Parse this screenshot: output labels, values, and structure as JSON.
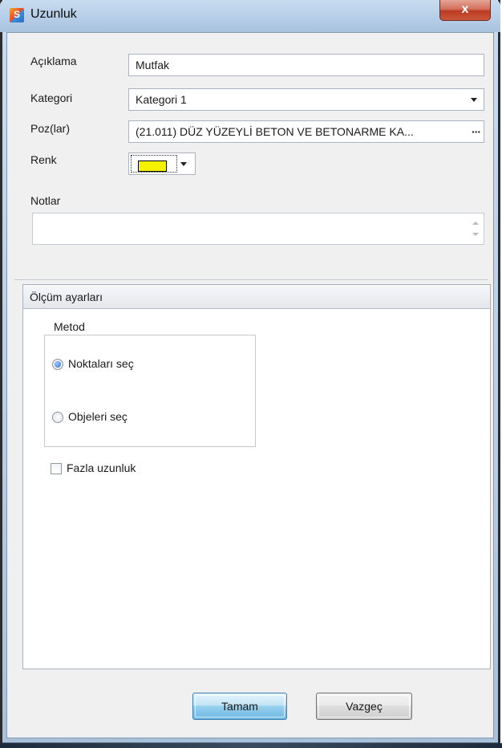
{
  "window": {
    "title": "Uzunluk",
    "close_glyph": "x"
  },
  "form": {
    "aciklama_label": "Açıklama",
    "aciklama_value": "Mutfak",
    "kategori_label": "Kategori",
    "kategori_value": "Kategori 1",
    "poz_label": "Poz(lar)",
    "poz_value": "(21.011) DÜZ YÜZEYLİ BETON VE BETONARME KA...",
    "poz_button": "···",
    "renk_label": "Renk",
    "renk_color": "#f5f200",
    "notlar_label": "Notlar",
    "notlar_value": ""
  },
  "measurement": {
    "group_title": "Ölçüm ayarları",
    "method_title": "Metod",
    "options": [
      {
        "label": "Noktaları seç",
        "selected": true
      },
      {
        "label": "Objeleri seç",
        "selected": false
      }
    ],
    "extra_length_label": "Fazla uzunluk",
    "extra_length_checked": false
  },
  "buttons": {
    "ok": "Tamam",
    "cancel": "Vazgeç"
  },
  "icons": {
    "app": "app-icon",
    "close": "close-icon",
    "dropdown": "chevron-down-icon",
    "more": "ellipsis-icon"
  }
}
